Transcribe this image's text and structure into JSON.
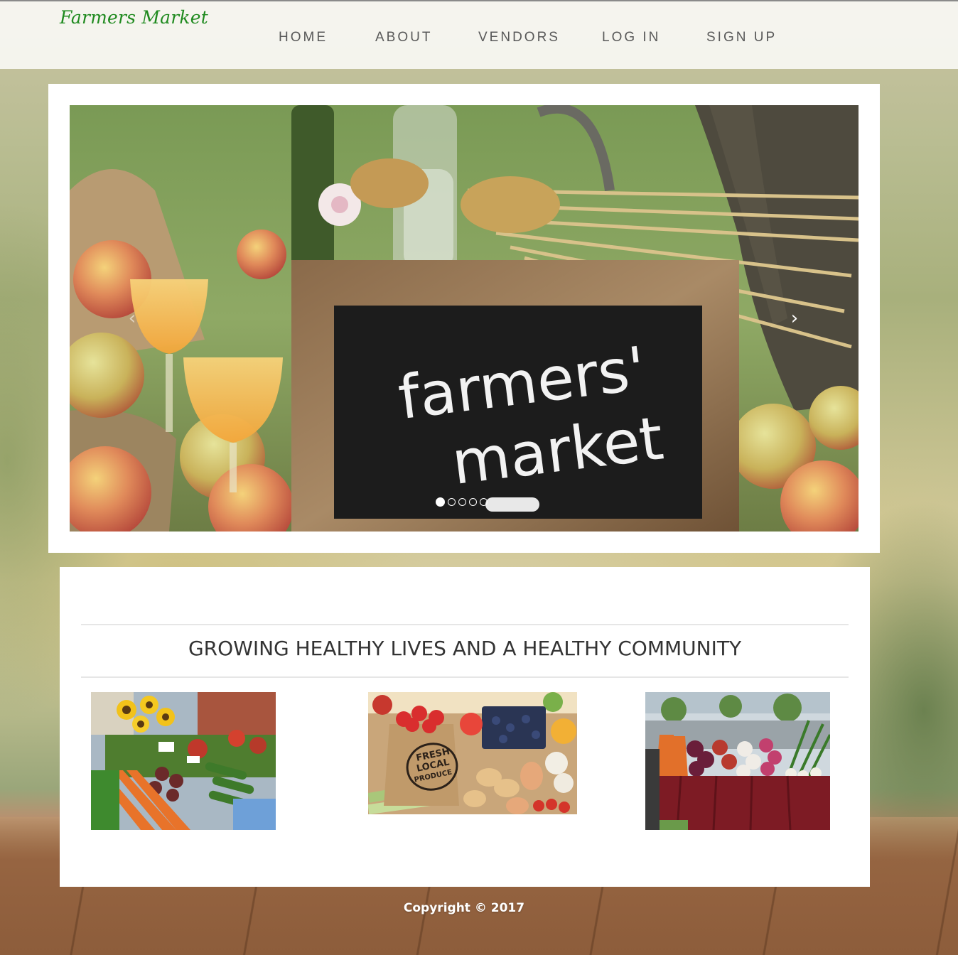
{
  "navbar": {
    "brand": "Farmers Market",
    "links": [
      "HOME",
      "ABOUT",
      "VENDORS",
      "LOG IN",
      "SIGN UP"
    ]
  },
  "carousel": {
    "slide_chalkboard_line1": "farmers'",
    "slide_chalkboard_line2": "market",
    "prev_glyph": "‹",
    "next_glyph": "›",
    "slide_count": 5,
    "active_slide": 1
  },
  "content": {
    "tagline": "GROWING HEALTHY LIVES AND A HEALTHY COMMUNITY",
    "bag_label_line1": "FRESH",
    "bag_label_line2": "LOCAL",
    "bag_label_line3": "PRODUCE"
  },
  "footer": {
    "copyright": "Copyright © 2017"
  }
}
